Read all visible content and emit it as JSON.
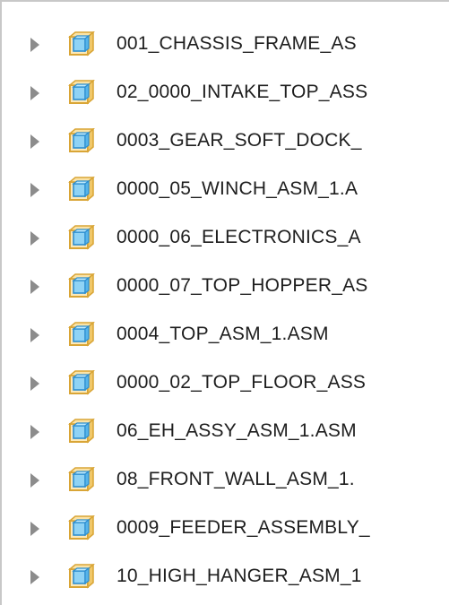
{
  "tree": {
    "items": [
      {
        "label": "001_CHASSIS_FRAME_AS"
      },
      {
        "label": "02_0000_INTAKE_TOP_ASS"
      },
      {
        "label": "0003_GEAR_SOFT_DOCK_"
      },
      {
        "label": "0000_05_WINCH_ASM_1.A"
      },
      {
        "label": "0000_06_ELECTRONICS_A"
      },
      {
        "label": "0000_07_TOP_HOPPER_AS"
      },
      {
        "label": "0004_TOP_ASM_1.ASM"
      },
      {
        "label": "0000_02_TOP_FLOOR_ASS"
      },
      {
        "label": "06_EH_ASSY_ASM_1.ASM"
      },
      {
        "label": "08_FRONT_WALL_ASM_1."
      },
      {
        "label": "0009_FEEDER_ASSEMBLY_"
      },
      {
        "label": "10_HIGH_HANGER_ASM_1"
      }
    ],
    "expander_icon": "triangle-right-icon",
    "node_icon": "assembly-icon",
    "colors": {
      "expander": "#8c8c8c",
      "text": "#1e1e1e",
      "icon_blue": "#4aa3df",
      "icon_gold": "#e0b44c"
    }
  }
}
